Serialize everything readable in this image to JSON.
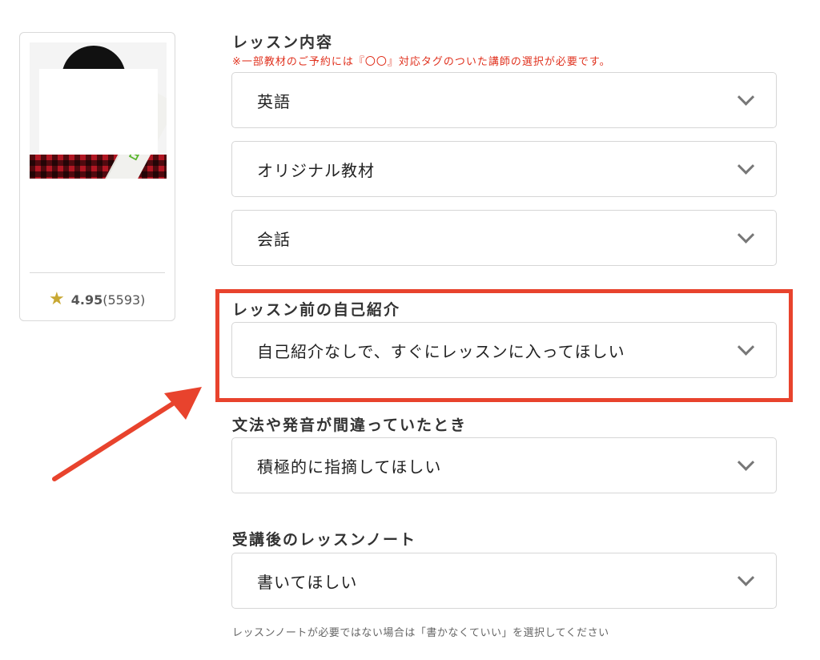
{
  "tutor": {
    "photo_icon": "tutor-photo",
    "sash_text": "日本",
    "rating_score": "4.95",
    "rating_count": "(5593)",
    "star_icon": "star-icon"
  },
  "sections": {
    "lesson_content": {
      "title": "レッスン内容",
      "notice": "※一部教材のご予約には『〇〇』対応タグのついた講師の選択が必要です。",
      "select_language": "英語",
      "select_material": "オリジナル教材",
      "select_topic": "会話"
    },
    "self_intro": {
      "title": "レッスン前の自己紹介",
      "value": "自己紹介なしで、すぐにレッスンに入ってほしい"
    },
    "correction": {
      "title": "文法や発音が間違っていたとき",
      "value": "積極的に指摘してほしい"
    },
    "lesson_note": {
      "title": "受講後のレッスンノート",
      "value": "書いてほしい",
      "help": "レッスンノートが必要ではない場合は「書かなくていい」を選択してください"
    }
  },
  "annotation": {
    "highlight_color": "#e8432d",
    "arrow_color": "#e8432d"
  }
}
